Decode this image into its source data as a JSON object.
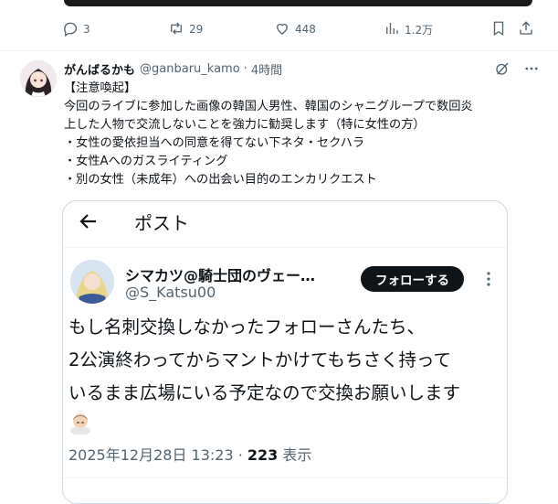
{
  "actions": {
    "reply_count": "3",
    "repost_count": "29",
    "like_count": "448",
    "view_count": "1.2万"
  },
  "post": {
    "author_name": "がんばるかも",
    "handle": "@ganbaru_kamo",
    "separator": "·",
    "time": "4時間",
    "lines": [
      "【注意喚起】",
      "今回のライブに参加した画像の韓国人男性、韓国のシャニグループで数回炎",
      "上した人物で交流しないことを強力に勧奨します（特に女性の方）",
      "・女性の愛依担当への同意を得てない下ネタ・セクハラ",
      "・女性Aへのガスライティング",
      "・別の女性（未成年）への出会い目的のエンカリクエスト"
    ]
  },
  "quote": {
    "title": "ポスト",
    "name": "シマカツ@騎士団のヴェー…",
    "handle": "@S_Katsu00",
    "follow_label": "フォローする",
    "lines": [
      "もし名刺交換しなかったフォローさんたち、",
      "2公演終わってからマントかけてもちさく持って",
      "いるまま広場にいる予定なので交換お願いします"
    ],
    "date": "2025年12月28日 13:23 · ",
    "views_number": "223",
    "views_label": " 表示"
  },
  "colors": {
    "text": "#0f1419",
    "secondary": "#536471",
    "border": "#cfd9de",
    "follow_bg": "#0f1419"
  }
}
